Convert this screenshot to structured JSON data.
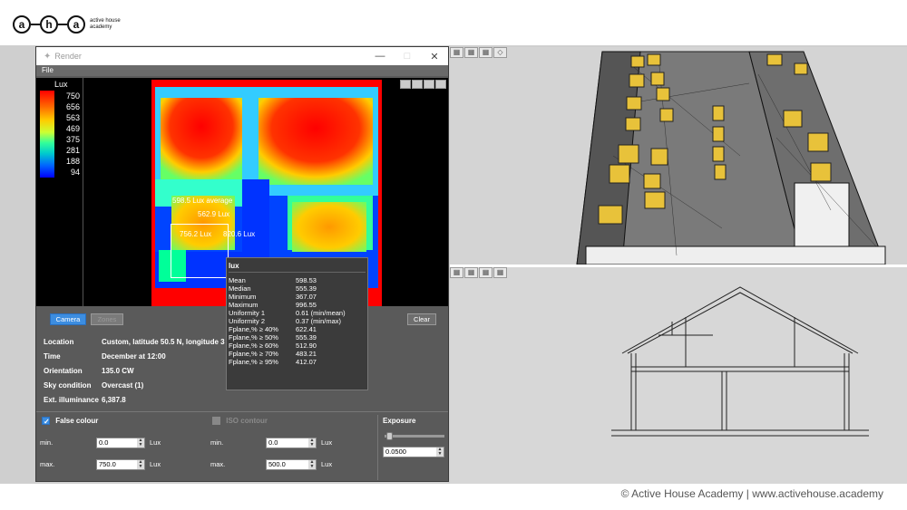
{
  "header": {
    "logo_letters": [
      "a",
      "h",
      "a"
    ],
    "logo_text": "active house academy"
  },
  "footer": {
    "credit": "© Active House Academy | www.activehouse.academy"
  },
  "window": {
    "title": "Render",
    "menu": [
      "File"
    ],
    "controls": {
      "minimize": "—",
      "maximize": "□",
      "close": "✕"
    }
  },
  "legend": {
    "title": "Lux",
    "values": [
      "750",
      "656",
      "563",
      "469",
      "375",
      "281",
      "188",
      "94"
    ]
  },
  "annotations": {
    "average": "598.5 Lux average",
    "p1": "562.9 Lux",
    "p2": "756.2 Lux",
    "p3": "820.6 Lux"
  },
  "stats": {
    "title": "lux",
    "rows": [
      {
        "k": "Mean",
        "v": "598.53"
      },
      {
        "k": "Median",
        "v": "555.39"
      },
      {
        "k": "Minimum",
        "v": "367.07"
      },
      {
        "k": "Maximum",
        "v": "996.55"
      },
      {
        "k": "Uniformity 1",
        "v": "0.61 (min/mean)"
      },
      {
        "k": "Uniformity 2",
        "v": "0.37 (min/max)"
      },
      {
        "k": "Fplane,% ≥ 40%",
        "v": "622.41"
      },
      {
        "k": "Fplane,% ≥ 50%",
        "v": "555.39"
      },
      {
        "k": "Fplane,% ≥ 60%",
        "v": "512.90"
      },
      {
        "k": "Fplane,% ≥ 70%",
        "v": "483.21"
      },
      {
        "k": "Fplane,% ≥ 95%",
        "v": "412.07"
      }
    ]
  },
  "buttons": {
    "camera": "Camera",
    "zones": "Zones",
    "clear": "Clear"
  },
  "info": [
    {
      "k": "Location",
      "v": "Custom, latitude 50.5 N, longitude 3"
    },
    {
      "k": "Time",
      "v": "December at 12:00"
    },
    {
      "k": "Orientation",
      "v": "135.0 CW"
    },
    {
      "k": "Sky condition",
      "v": "Overcast (1)"
    },
    {
      "k": "Ext. illuminance",
      "v": "6,387.8"
    }
  ],
  "false_colour": {
    "label": "False colour",
    "checked": true,
    "min_label": "min.",
    "min_value": "0.0",
    "max_label": "max.",
    "max_value": "750.0",
    "unit": "Lux"
  },
  "iso_contour": {
    "label": "ISO contour",
    "checked": false,
    "min_label": "min.",
    "min_value": "0.0",
    "max_label": "max.",
    "max_value": "500.0",
    "unit": "Lux"
  },
  "exposure": {
    "label": "Exposure",
    "value": "0.0500"
  }
}
